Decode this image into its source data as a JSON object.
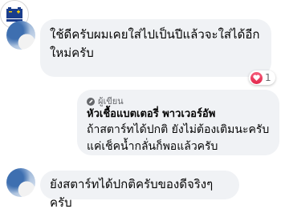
{
  "comments": [
    {
      "text": "ใช้ดีครับผมเคยใส่ไปเป็นปีแล้วจะใส่ได้อีกใหม่ครับ",
      "reaction_count": "1"
    },
    {
      "author_tag": "ผู้เขียน",
      "author": "หัวเชื้อแบตเตอรี่ พาวเวอร์อัพ",
      "text": "ถ้าสตาร์ทได้ปกติ ยังไม่ต้องเติมนะครับ แค่เช็คน้ำกลั่นก็พอแล้วครับ",
      "logo": "battery-power-up-logo"
    },
    {
      "text": "ยังสตาร์ทได้ปกติครับของดีจริงๆครับ"
    }
  ],
  "colors": {
    "bubble": "#f0f2f5",
    "reaction": "#e3274c",
    "text": "#050505",
    "meta": "#65676b"
  },
  "icons": [
    "heart-reaction-icon",
    "author-badge-icon"
  ]
}
